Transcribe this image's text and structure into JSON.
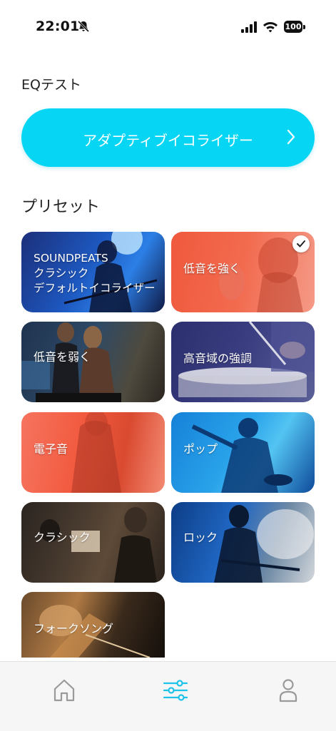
{
  "status": {
    "time": "22:01",
    "battery": "100",
    "icons": [
      "bell-off-icon",
      "signal-icon",
      "wifi-icon",
      "battery-icon"
    ]
  },
  "eq_section": {
    "title": "EQテスト",
    "adaptive_button_label": "アダプティブイコライザー"
  },
  "preset_section": {
    "title": "プリセット",
    "presets": [
      {
        "label_lines": [
          "SOUNDPEATS",
          "クラシック",
          "デフォルトイコライザー"
        ],
        "selected": false
      },
      {
        "label": "低音を強く",
        "selected": true
      },
      {
        "label": "低音を弱く",
        "selected": false
      },
      {
        "label": "高音域の強調",
        "selected": false
      },
      {
        "label": "電子音",
        "selected": false
      },
      {
        "label": "ポップ",
        "selected": false
      },
      {
        "label": "クラシック",
        "selected": false
      },
      {
        "label": "ロック",
        "selected": false
      },
      {
        "label": "フォークソング",
        "selected": false
      }
    ]
  },
  "tab_bar": {
    "items": [
      {
        "name": "home",
        "icon": "home-icon",
        "active": false
      },
      {
        "name": "equalizer",
        "icon": "sliders-icon",
        "active": true
      },
      {
        "name": "profile",
        "icon": "person-icon",
        "active": false
      }
    ]
  },
  "colors": {
    "accent": "#06d6f4",
    "active_tab": "#1ec3ea",
    "inactive_tab": "#9a9a9a"
  }
}
